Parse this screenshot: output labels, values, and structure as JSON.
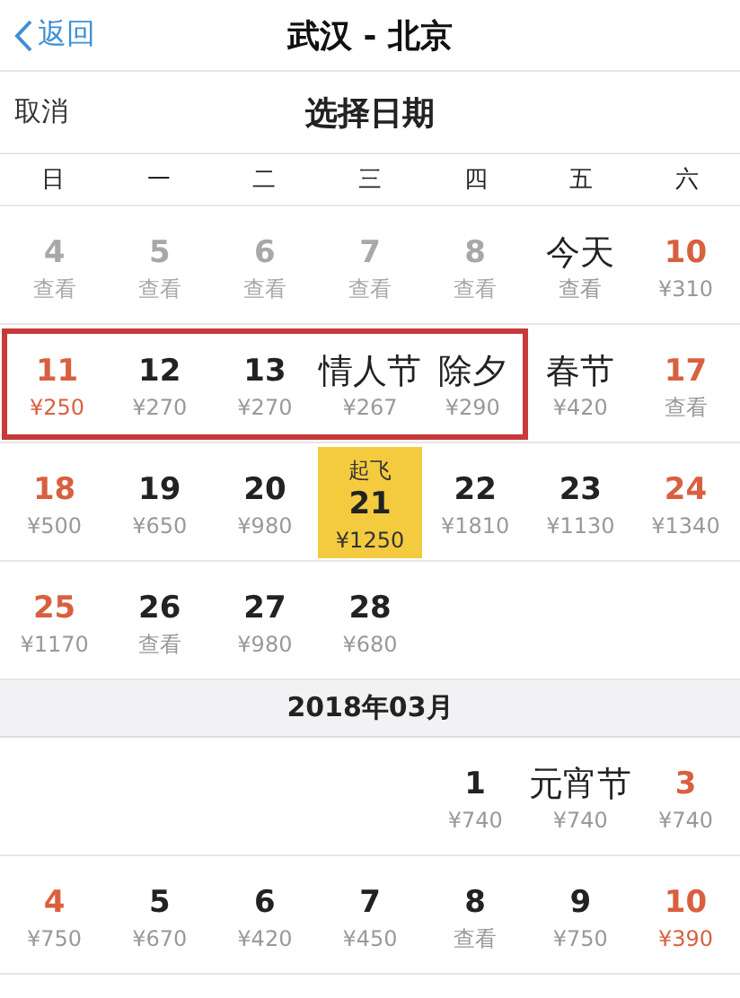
{
  "nav_bar": {
    "back": "返回",
    "title": "武汉 - 北京"
  },
  "date_bar": {
    "cancel": "取消",
    "title": "选择日期"
  },
  "weekdays": [
    {
      "label": "日",
      "weekend": false
    },
    {
      "label": "一",
      "weekend": false
    },
    {
      "label": "二",
      "weekend": false
    },
    {
      "label": "三",
      "weekend": false
    },
    {
      "label": "四",
      "weekend": false
    },
    {
      "label": "五",
      "weekend": false
    },
    {
      "label": "六",
      "weekend": false
    }
  ],
  "months": [
    {
      "weeks": [
        [
          {
            "kind": "date",
            "day": "4",
            "price": "查看",
            "weekend": true,
            "disabled": true,
            "selected": false,
            "highlighted": false,
            "cheapest": false
          },
          {
            "kind": "date",
            "day": "5",
            "price": "查看",
            "weekend": false,
            "disabled": true,
            "selected": false,
            "highlighted": false,
            "cheapest": false
          },
          {
            "kind": "date",
            "day": "6",
            "price": "查看",
            "weekend": false,
            "disabled": true,
            "selected": false,
            "highlighted": false,
            "cheapest": false
          },
          {
            "kind": "date",
            "day": "7",
            "price": "查看",
            "weekend": false,
            "disabled": true,
            "selected": false,
            "highlighted": false,
            "cheapest": false
          },
          {
            "kind": "date",
            "day": "8",
            "price": "查看",
            "weekend": false,
            "disabled": true,
            "selected": false,
            "highlighted": false,
            "cheapest": false
          },
          {
            "kind": "holiday",
            "day": "今天",
            "price": "查看",
            "weekend": false,
            "disabled": false,
            "selected": false,
            "highlighted": false,
            "cheapest": false
          },
          {
            "kind": "date",
            "day": "10",
            "price": "¥310",
            "weekend": true,
            "disabled": false,
            "selected": false,
            "highlighted": false,
            "cheapest": false
          }
        ],
        [
          {
            "kind": "date",
            "day": "11",
            "price": "¥250",
            "weekend": true,
            "disabled": false,
            "selected": false,
            "highlighted": true,
            "cheapest": true
          },
          {
            "kind": "date",
            "day": "12",
            "price": "¥270",
            "weekend": false,
            "disabled": false,
            "selected": false,
            "highlighted": true,
            "cheapest": false
          },
          {
            "kind": "date",
            "day": "13",
            "price": "¥270",
            "weekend": false,
            "disabled": false,
            "selected": false,
            "highlighted": true,
            "cheapest": false
          },
          {
            "kind": "holiday",
            "day": "情人节",
            "price": "¥267",
            "weekend": false,
            "disabled": false,
            "selected": false,
            "highlighted": true,
            "cheapest": false
          },
          {
            "kind": "holiday",
            "day": "除夕",
            "price": "¥290",
            "weekend": false,
            "disabled": false,
            "selected": false,
            "highlighted": true,
            "cheapest": false
          },
          {
            "kind": "holiday",
            "day": "春节",
            "price": "¥420",
            "weekend": false,
            "disabled": false,
            "selected": false,
            "highlighted": false,
            "cheapest": false
          },
          {
            "kind": "date",
            "day": "17",
            "price": "查看",
            "weekend": true,
            "disabled": false,
            "selected": false,
            "highlighted": false,
            "cheapest": false
          }
        ],
        [
          {
            "kind": "date",
            "day": "18",
            "price": "¥500",
            "weekend": true,
            "disabled": false,
            "selected": false,
            "highlighted": false,
            "cheapest": false
          },
          {
            "kind": "date",
            "day": "19",
            "price": "¥650",
            "weekend": false,
            "disabled": false,
            "selected": false,
            "highlighted": false,
            "cheapest": false
          },
          {
            "kind": "date",
            "day": "20",
            "price": "¥980",
            "weekend": false,
            "disabled": false,
            "selected": false,
            "highlighted": false,
            "cheapest": false
          },
          {
            "kind": "date",
            "day": "21",
            "label": "起飞",
            "price": "¥1250",
            "weekend": false,
            "disabled": false,
            "selected": true,
            "highlighted": false,
            "cheapest": false
          },
          {
            "kind": "date",
            "day": "22",
            "price": "¥1810",
            "weekend": false,
            "disabled": false,
            "selected": false,
            "highlighted": false,
            "cheapest": false
          },
          {
            "kind": "date",
            "day": "23",
            "price": "¥1130",
            "weekend": false,
            "disabled": false,
            "selected": false,
            "highlighted": false,
            "cheapest": false
          },
          {
            "kind": "date",
            "day": "24",
            "price": "¥1340",
            "weekend": true,
            "disabled": false,
            "selected": false,
            "highlighted": false,
            "cheapest": false
          }
        ],
        [
          {
            "kind": "date",
            "day": "25",
            "price": "¥1170",
            "weekend": true,
            "disabled": false,
            "selected": false,
            "highlighted": false,
            "cheapest": false
          },
          {
            "kind": "date",
            "day": "26",
            "price": "查看",
            "weekend": false,
            "disabled": false,
            "selected": false,
            "highlighted": false,
            "cheapest": false
          },
          {
            "kind": "date",
            "day": "27",
            "price": "¥980",
            "weekend": false,
            "disabled": false,
            "selected": false,
            "highlighted": false,
            "cheapest": false
          },
          {
            "kind": "date",
            "day": "28",
            "price": "¥680",
            "weekend": false,
            "disabled": false,
            "selected": false,
            "highlighted": false,
            "cheapest": false
          },
          {
            "kind": "blank"
          },
          {
            "kind": "blank"
          },
          {
            "kind": "blank"
          }
        ]
      ]
    },
    {
      "header": "2018年03月",
      "weeks": [
        [
          {
            "kind": "blank"
          },
          {
            "kind": "blank"
          },
          {
            "kind": "blank"
          },
          {
            "kind": "blank"
          },
          {
            "kind": "date",
            "day": "1",
            "price": "¥740",
            "weekend": false,
            "disabled": false,
            "selected": false,
            "highlighted": false,
            "cheapest": false
          },
          {
            "kind": "holiday",
            "day": "元宵节",
            "price": "¥740",
            "weekend": false,
            "disabled": false,
            "selected": false,
            "highlighted": false,
            "cheapest": false
          },
          {
            "kind": "date",
            "day": "3",
            "price": "¥740",
            "weekend": true,
            "disabled": false,
            "selected": false,
            "highlighted": false,
            "cheapest": false
          }
        ],
        [
          {
            "kind": "date",
            "day": "4",
            "price": "¥750",
            "weekend": true,
            "disabled": false,
            "selected": false,
            "highlighted": false,
            "cheapest": false
          },
          {
            "kind": "date",
            "day": "5",
            "price": "¥670",
            "weekend": false,
            "disabled": false,
            "selected": false,
            "highlighted": false,
            "cheapest": false
          },
          {
            "kind": "date",
            "day": "6",
            "price": "¥420",
            "weekend": false,
            "disabled": false,
            "selected": false,
            "highlighted": false,
            "cheapest": false
          },
          {
            "kind": "date",
            "day": "7",
            "price": "¥450",
            "weekend": false,
            "disabled": false,
            "selected": false,
            "highlighted": false,
            "cheapest": false
          },
          {
            "kind": "date",
            "day": "8",
            "price": "查看",
            "weekend": false,
            "disabled": false,
            "selected": false,
            "highlighted": false,
            "cheapest": false
          },
          {
            "kind": "date",
            "day": "9",
            "price": "¥750",
            "weekend": false,
            "disabled": false,
            "selected": false,
            "highlighted": false,
            "cheapest": false
          },
          {
            "kind": "date",
            "day": "10",
            "price": "¥390",
            "weekend": true,
            "disabled": false,
            "selected": false,
            "highlighted": false,
            "cheapest": true
          }
        ]
      ]
    }
  ]
}
